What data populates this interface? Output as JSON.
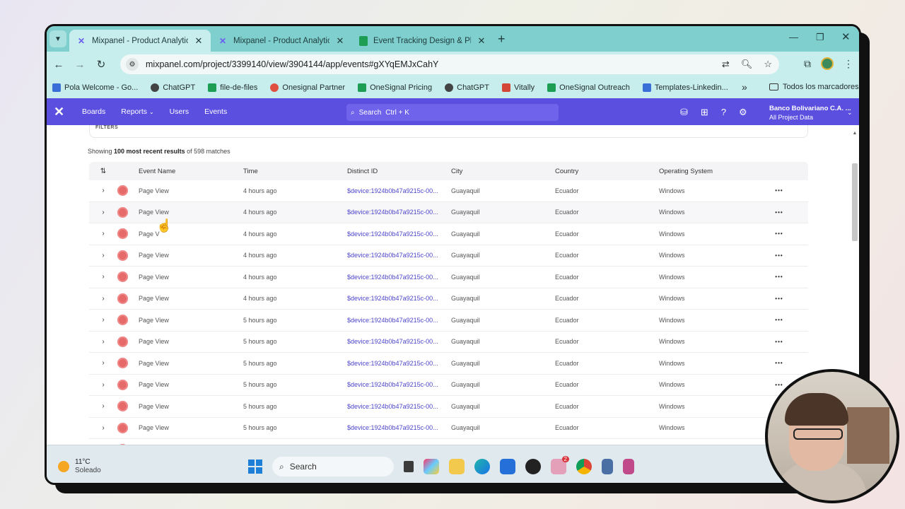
{
  "browser": {
    "tabs": [
      {
        "title": "Mixpanel - Product Analytics",
        "icon": "mixpanel-icon",
        "active": true
      },
      {
        "title": "Mixpanel - Product Analytics",
        "icon": "mixpanel-icon",
        "active": false
      },
      {
        "title": "Event Tracking Design & Planif",
        "icon": "sheets-icon",
        "active": false
      }
    ],
    "url": "mixpanel.com/project/3399140/view/3904144/app/events#gXYqEMJxCahY",
    "bookmarks": [
      {
        "label": "Pola Welcome - Go...",
        "icon": "docs-icon",
        "color": "#3b6fd8"
      },
      {
        "label": "ChatGPT",
        "icon": "chatgpt-icon",
        "color": "#444444"
      },
      {
        "label": "file-de-files",
        "icon": "sheets-icon",
        "color": "#1e9e55"
      },
      {
        "label": "Onesignal Partner",
        "icon": "onesignal-icon",
        "color": "#e05040"
      },
      {
        "label": "OneSignal Pricing",
        "icon": "sheets-icon",
        "color": "#1e9e55"
      },
      {
        "label": "ChatGPT",
        "icon": "chatgpt-icon",
        "color": "#444444"
      },
      {
        "label": "Vitally",
        "icon": "gmail-icon",
        "color": "#d44638"
      },
      {
        "label": "OneSignal Outreach",
        "icon": "sheets-icon",
        "color": "#1e9e55"
      },
      {
        "label": "Templates-Linkedin...",
        "icon": "docs-icon",
        "color": "#3b6fd8"
      }
    ],
    "all_bookmarks": "Todos los marcadores"
  },
  "mixpanel": {
    "nav": [
      "Boards",
      "Reports",
      "Users",
      "Events"
    ],
    "search_label": "Search",
    "search_shortcut": "Ctrl + K",
    "project_name": "Banco Bolivariano C.A. ...",
    "project_sub": "All Project Data",
    "brand_color": "#5b4fe0"
  },
  "events": {
    "filters_label": "FILTERS",
    "showing_prefix": "Showing ",
    "showing_bold": "100 most recent results",
    "showing_suffix": " of 598 matches",
    "columns": [
      "Event Name",
      "Time",
      "Distinct ID",
      "City",
      "Country",
      "Operating System"
    ],
    "rows": [
      {
        "name": "Page View",
        "time": "4 hours ago",
        "id": "$device:1924b0b47a9215c-00...",
        "city": "Guayaquil",
        "country": "Ecuador",
        "os": "Windows"
      },
      {
        "name": "Page View",
        "time": "4 hours ago",
        "id": "$device:1924b0b47a9215c-00...",
        "city": "Guayaquil",
        "country": "Ecuador",
        "os": "Windows"
      },
      {
        "name": "Page V",
        "time": "4 hours ago",
        "id": "$device:1924b0b47a9215c-00...",
        "city": "Guayaquil",
        "country": "Ecuador",
        "os": "Windows"
      },
      {
        "name": "Page View",
        "time": "4 hours ago",
        "id": "$device:1924b0b47a9215c-00...",
        "city": "Guayaquil",
        "country": "Ecuador",
        "os": "Windows"
      },
      {
        "name": "Page View",
        "time": "4 hours ago",
        "id": "$device:1924b0b47a9215c-00...",
        "city": "Guayaquil",
        "country": "Ecuador",
        "os": "Windows"
      },
      {
        "name": "Page View",
        "time": "4 hours ago",
        "id": "$device:1924b0b47a9215c-00...",
        "city": "Guayaquil",
        "country": "Ecuador",
        "os": "Windows"
      },
      {
        "name": "Page View",
        "time": "5 hours ago",
        "id": "$device:1924b0b47a9215c-00...",
        "city": "Guayaquil",
        "country": "Ecuador",
        "os": "Windows"
      },
      {
        "name": "Page View",
        "time": "5 hours ago",
        "id": "$device:1924b0b47a9215c-00...",
        "city": "Guayaquil",
        "country": "Ecuador",
        "os": "Windows"
      },
      {
        "name": "Page View",
        "time": "5 hours ago",
        "id": "$device:1924b0b47a9215c-00...",
        "city": "Guayaquil",
        "country": "Ecuador",
        "os": "Windows"
      },
      {
        "name": "Page View",
        "time": "5 hours ago",
        "id": "$device:1924b0b47a9215c-00...",
        "city": "Guayaquil",
        "country": "Ecuador",
        "os": "Windows"
      },
      {
        "name": "Page View",
        "time": "5 hours ago",
        "id": "$device:1924b0b47a9215c-00...",
        "city": "Guayaquil",
        "country": "Ecuador",
        "os": "Windows"
      },
      {
        "name": "Page View",
        "time": "5 hours ago",
        "id": "$device:1924b0b47a9215c-00...",
        "city": "Guayaquil",
        "country": "Ecuador",
        "os": "Windows"
      },
      {
        "name": "Page View",
        "time": "5 hours ago",
        "id": "$device:1924b0b47a9215c-00...",
        "city": "Guayaquil",
        "country": "Ecuador",
        "os": "Windows"
      }
    ]
  },
  "taskbar": {
    "temperature": "11°C",
    "weather": "Soleado",
    "search_label": "Search",
    "slack_badge": "2"
  }
}
